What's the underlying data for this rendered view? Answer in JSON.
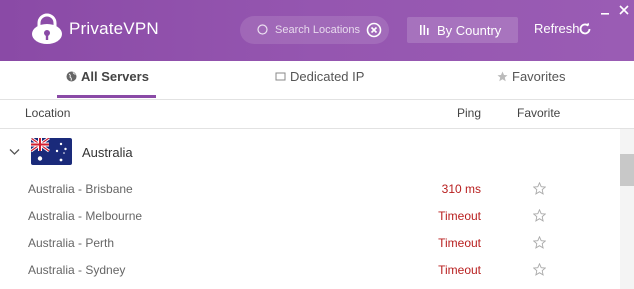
{
  "header": {
    "brand": "PrivateVPN",
    "search": {
      "placeholder": "Search Locations",
      "value": ""
    },
    "by_country_label": "By Country",
    "refresh_label": "Refresh"
  },
  "tabs": [
    {
      "label": "All Servers",
      "icon": "globe-icon",
      "active": true
    },
    {
      "label": "Dedicated IP",
      "icon": "box-icon",
      "active": false
    },
    {
      "label": "Favorites",
      "icon": "star-icon",
      "active": false
    }
  ],
  "columns": {
    "location": "Location",
    "ping": "Ping",
    "favorite": "Favorite"
  },
  "country": {
    "name": "Australia",
    "expanded": true,
    "flag": "australia-flag"
  },
  "servers": [
    {
      "name": "Australia - Brisbane",
      "ping": "310 ms"
    },
    {
      "name": "Australia - Melbourne",
      "ping": "Timeout"
    },
    {
      "name": "Australia - Perth",
      "ping": "Timeout"
    },
    {
      "name": "Australia - Sydney",
      "ping": "Timeout"
    }
  ],
  "colors": {
    "header_purple": "#8a4aa6",
    "ping_red": "#b81e1e",
    "tab_accent": "#8a4aa6"
  }
}
